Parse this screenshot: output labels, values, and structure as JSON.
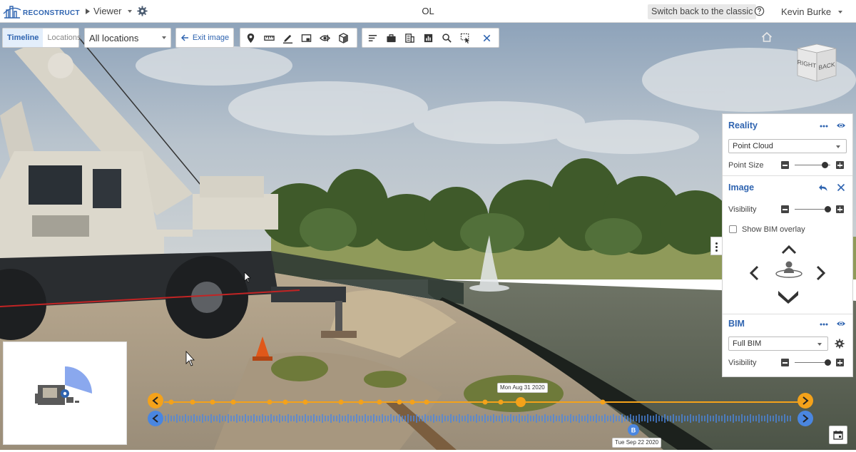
{
  "header": {
    "logo_text": "RECONSTRUCT",
    "viewer_label": "Viewer",
    "project_title": "OL",
    "classic_button": "Switch back to the classic",
    "user_name": "Kevin Burke"
  },
  "toolbar": {
    "tabs": [
      {
        "label": "Timeline",
        "active": true
      },
      {
        "label": "Locations",
        "active": false
      }
    ],
    "location_select": "All locations",
    "exit_image": "Exit image",
    "tool_icons": [
      "map-pin-icon",
      "ruler-icon",
      "pen-icon",
      "snapshot-icon",
      "view-eye-icon",
      "cube-icon"
    ],
    "action_icons": [
      "list-icon",
      "briefcase-icon",
      "building-icon",
      "chart-icon",
      "search-icon",
      "select-cursor-icon",
      "close-icon"
    ]
  },
  "nav_cube": {
    "left_face": "RIGHT",
    "right_face": "BACK"
  },
  "panel": {
    "reality": {
      "title": "Reality",
      "mode": "Point Cloud",
      "point_size_label": "Point Size",
      "point_size_level": 0.85
    },
    "image": {
      "title": "Image",
      "visibility_label": "Visibility",
      "visibility_level": 0.92,
      "bim_overlay_label": "Show BIM overlay",
      "bim_overlay_checked": false
    },
    "bim": {
      "title": "BIM",
      "mode": "Full BIM",
      "visibility_label": "Visibility",
      "visibility_level": 0.92
    }
  },
  "timeline": {
    "top_date": "Mon Aug 31 2020",
    "bottom_date": "Tue Sep 22 2020",
    "bottom_marker": "B"
  },
  "colors": {
    "accent_blue": "#2f64b0",
    "timeline_orange": "#f4a21a",
    "timeline_blue": "#4a86e0"
  }
}
